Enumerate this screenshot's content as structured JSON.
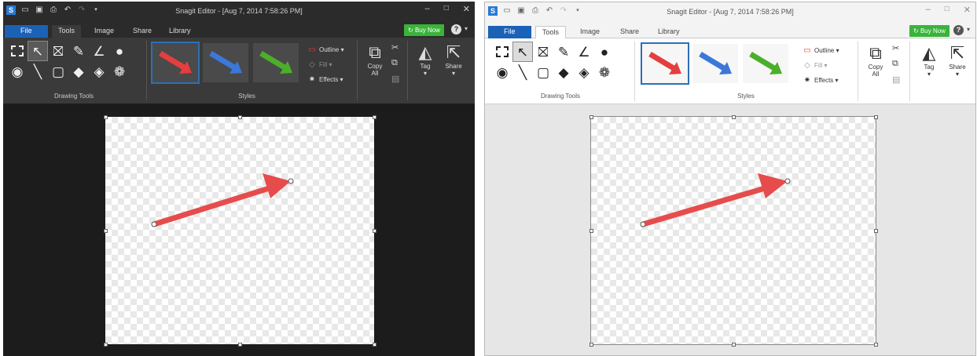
{
  "app": {
    "title": "Snagit Editor - [Aug 7, 2014 7:58:26 PM]",
    "window_controls": {
      "minimize": "–",
      "maximize": "□",
      "close": "✕"
    },
    "quick_access_icons": [
      "snagit-logo",
      "open-icon",
      "save-icon",
      "print-icon",
      "undo-icon",
      "redo-icon",
      "customize-arrow-icon"
    ]
  },
  "tabs": [
    "File",
    "Tools",
    "Image",
    "Share",
    "Library"
  ],
  "active_tab": "Tools",
  "buy_now": "Buy Now",
  "help_glyph": "?",
  "ribbon": {
    "drawing_tools_label": "Drawing Tools",
    "styles_label": "Styles",
    "tools": [
      {
        "name": "selection-tool",
        "icon": "dashed-rectangle-icon"
      },
      {
        "name": "arrow-tool",
        "icon": "arrow-cursor-icon",
        "selected": true
      },
      {
        "name": "stamp-tool",
        "icon": "stamp-icon"
      },
      {
        "name": "pen-tool",
        "icon": "pen-icon"
      },
      {
        "name": "highlighter-tool",
        "icon": "highlighter-icon"
      },
      {
        "name": "fill-tool",
        "icon": "droplet-icon"
      },
      {
        "name": "callout-tool",
        "icon": "callout-icon"
      },
      {
        "name": "line-tool",
        "icon": "line-icon"
      },
      {
        "name": "shape-tool",
        "icon": "shape-icon"
      },
      {
        "name": "fill-bucket-tool",
        "icon": "fill-bucket-icon"
      },
      {
        "name": "eraser-tool",
        "icon": "eraser-icon"
      },
      {
        "name": "step-tool",
        "icon": "step-icon"
      }
    ],
    "styles": [
      {
        "name": "red-arrow-style",
        "color": "#e53e3e",
        "selected": true
      },
      {
        "name": "blue-arrow-style",
        "color": "#3b78d8"
      },
      {
        "name": "green-arrow-style",
        "color": "#4caf2a"
      }
    ],
    "style_props": {
      "outline": "Outline ▾",
      "fill": "Fill ▾",
      "effects": "Effects ▾"
    },
    "copy_all": [
      "Copy",
      "All"
    ],
    "tag": "Tag",
    "share": "Share"
  },
  "canvas": {
    "arrow_color": "#e74c4c",
    "background": "transparent-checkerboard"
  },
  "colors": {
    "file_tab": "#1b62b7",
    "buy_now": "#3ab33a",
    "selected_style_border": "#2d6fb6"
  }
}
